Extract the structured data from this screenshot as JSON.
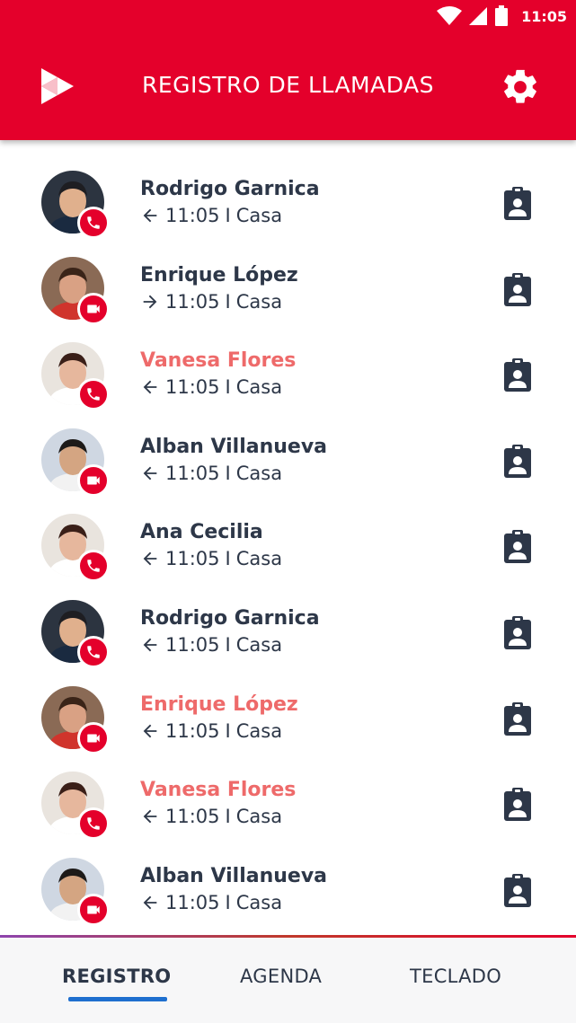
{
  "status_bar": {
    "time": "11:05",
    "icons": [
      "wifi-icon",
      "signal-icon",
      "battery-icon"
    ]
  },
  "header": {
    "title": "REGISTRO DE LLAMADAS",
    "logo_icon": "app-logo-icon",
    "settings_icon": "gear-icon"
  },
  "colors": {
    "brand_red": "#e4002b",
    "text_dark": "#2d3748",
    "missed_text": "#ee6a6a",
    "tab_indicator": "#1f6fcf"
  },
  "calls": [
    {
      "name": "Rodrigo Garnica",
      "direction": "incoming",
      "direction_icon": "arrow-left-icon",
      "time": "11:05",
      "separator": "I",
      "label": "Casa",
      "type": "voice",
      "badge_icon": "phone-icon",
      "missed": false
    },
    {
      "name": "Enrique López",
      "direction": "outgoing",
      "direction_icon": "arrow-right-icon",
      "time": "11:05",
      "separator": "I",
      "label": "Casa",
      "type": "video",
      "badge_icon": "video-icon",
      "missed": false
    },
    {
      "name": "Vanesa Flores",
      "direction": "incoming",
      "direction_icon": "arrow-left-icon",
      "time": "11:05",
      "separator": "I",
      "label": "Casa",
      "type": "voice",
      "badge_icon": "phone-icon",
      "missed": true
    },
    {
      "name": "Alban Villanueva",
      "direction": "incoming",
      "direction_icon": "arrow-left-icon",
      "time": "11:05",
      "separator": "I",
      "label": "Casa",
      "type": "video",
      "badge_icon": "video-icon",
      "missed": false
    },
    {
      "name": "Ana Cecilia",
      "direction": "incoming",
      "direction_icon": "arrow-left-icon",
      "time": "11:05",
      "separator": "I",
      "label": "Casa",
      "type": "voice",
      "badge_icon": "phone-icon",
      "missed": false
    },
    {
      "name": "Rodrigo Garnica",
      "direction": "incoming",
      "direction_icon": "arrow-left-icon",
      "time": "11:05",
      "separator": "I",
      "label": "Casa",
      "type": "voice",
      "badge_icon": "phone-icon",
      "missed": false
    },
    {
      "name": "Enrique López",
      "direction": "incoming",
      "direction_icon": "arrow-left-icon",
      "time": "11:05",
      "separator": "I",
      "label": "Casa",
      "type": "video",
      "badge_icon": "video-icon",
      "missed": true
    },
    {
      "name": "Vanesa Flores",
      "direction": "incoming",
      "direction_icon": "arrow-left-icon",
      "time": "11:05",
      "separator": "I",
      "label": "Casa",
      "type": "voice",
      "badge_icon": "phone-icon",
      "missed": true
    },
    {
      "name": "Alban Villanueva",
      "direction": "incoming",
      "direction_icon": "arrow-left-icon",
      "time": "11:05",
      "separator": "I",
      "label": "Casa",
      "type": "video",
      "badge_icon": "video-icon",
      "missed": false
    }
  ],
  "contact_action_icon": "contact-card-icon",
  "bottom_nav": {
    "tabs": [
      {
        "label": "REGISTRO",
        "active": true
      },
      {
        "label": "AGENDA",
        "active": false
      },
      {
        "label": "TECLADO",
        "active": false
      }
    ]
  }
}
